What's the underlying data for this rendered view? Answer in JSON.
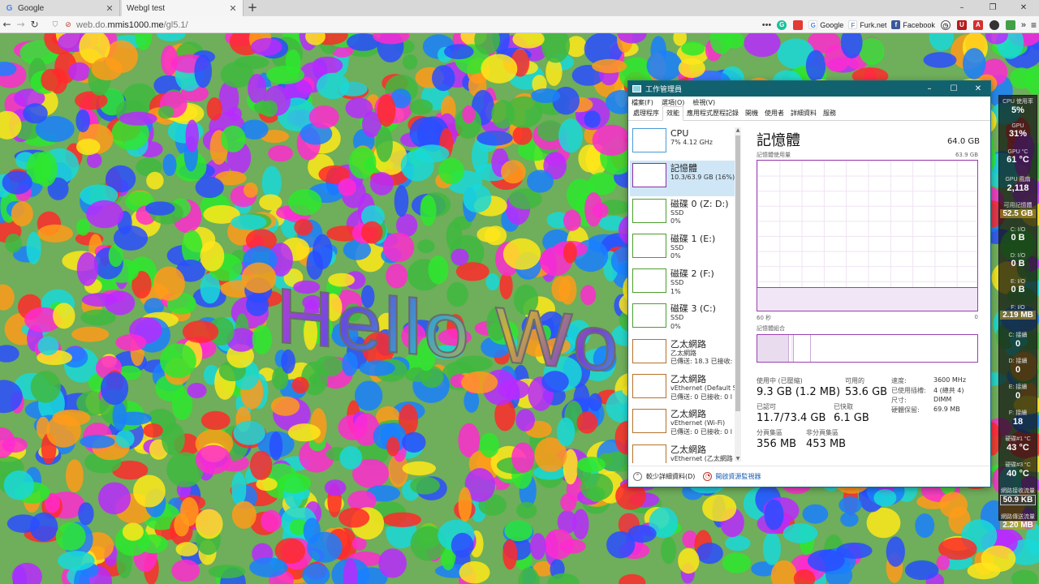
{
  "browser": {
    "tabs": [
      {
        "label": "Google",
        "favicon": "G"
      },
      {
        "label": "Webgl test",
        "favicon": ""
      }
    ],
    "url_prefix": "web.do.",
    "url_host": "mmis1000.me",
    "url_path": "/gl5.1/",
    "bookmarks": [
      "Google",
      "Furk.net",
      "Facebook"
    ],
    "window_controls": [
      "–",
      "❐",
      "✕"
    ]
  },
  "canvas": {
    "text": "Hello Wo"
  },
  "taskmgr": {
    "title": "工作管理員",
    "menu": [
      "檔案(F)",
      "選項(O)",
      "檢視(V)"
    ],
    "tabs": [
      "處理程序",
      "效能",
      "應用程式歷程記錄",
      "開機",
      "使用者",
      "詳細資料",
      "服務"
    ],
    "active_tab": "效能",
    "items": [
      {
        "name": "CPU",
        "sub1": "7% 4.12 GHz",
        "sub2": "",
        "sub3": "",
        "kind": "cpu"
      },
      {
        "name": "記憶體",
        "sub1": "10.3/63.9 GB (16%)",
        "sub2": "",
        "sub3": "",
        "kind": "mem"
      },
      {
        "name": "磁碟 0 (Z: D:)",
        "sub1": "SSD",
        "sub2": "0%",
        "sub3": "",
        "kind": "disk"
      },
      {
        "name": "磁碟 1 (E:)",
        "sub1": "SSD",
        "sub2": "0%",
        "sub3": "",
        "kind": "disk"
      },
      {
        "name": "磁碟 2 (F:)",
        "sub1": "SSD",
        "sub2": "1%",
        "sub3": "",
        "kind": "disk"
      },
      {
        "name": "磁碟 3 (C:)",
        "sub1": "SSD",
        "sub2": "0%",
        "sub3": "",
        "kind": "disk"
      },
      {
        "name": "乙太網路",
        "sub1": "乙太網路",
        "sub2": "已傳送: 18.3 已接收:",
        "sub3": "",
        "kind": "net"
      },
      {
        "name": "乙太網路",
        "sub1": "vEthernet (Default S",
        "sub2": "已傳送: 0 已接收: 0 l",
        "sub3": "",
        "kind": "net"
      },
      {
        "name": "乙太網路",
        "sub1": "vEthernet (Wi-Fi)",
        "sub2": "已傳送: 0 已接收: 0 l",
        "sub3": "",
        "kind": "net"
      },
      {
        "name": "乙太網路",
        "sub1": "vEthernet (乙太網路",
        "sub2": "",
        "sub3": "",
        "kind": "net"
      }
    ],
    "detail": {
      "title": "記憶體",
      "total": "64.0 GB",
      "usage_label": "記憶體使用量",
      "usage_max": "63.9 GB",
      "axis_left": "60 秒",
      "axis_right": "0",
      "composition_label": "記憶體組合",
      "stats": {
        "in_use_label": "使用中 (已壓縮)",
        "in_use_value": "9.3 GB (1.2 MB)",
        "available_label": "可用的",
        "available_value": "53.6 GB",
        "committed_label": "已認可",
        "committed_value": "11.7/73.4 GB",
        "cached_label": "已快取",
        "cached_value": "6.1 GB",
        "paged_label": "分頁集區",
        "paged_value": "356 MB",
        "nonpaged_label": "非分頁集區",
        "nonpaged_value": "453 MB"
      },
      "props": [
        {
          "k": "速度:",
          "v": "3600 MHz"
        },
        {
          "k": "已使用插槽:",
          "v": "4 (總共 4)"
        },
        {
          "k": "尺寸:",
          "v": "DIMM"
        },
        {
          "k": "硬體保留:",
          "v": "69.9 MB"
        }
      ]
    },
    "footer": {
      "fewer_details": "較少詳細資料(D)",
      "open_monitor": "開啟資源監視器"
    }
  },
  "gadget": {
    "rows": [
      {
        "label": "CPU 使用率",
        "value": "5%",
        "style": ""
      },
      {
        "label": "GPU",
        "value": "31%",
        "style": ""
      },
      {
        "label": "GPU °C",
        "value": "61 °C",
        "style": ""
      },
      {
        "label": "GPU 風扇",
        "value": "2,118",
        "style": ""
      },
      {
        "label": "可用記憶體",
        "value": "52.5 GB",
        "style": "boxed"
      },
      {
        "label": "C: I/O",
        "value": "0 B",
        "style": ""
      },
      {
        "label": "D: I/O",
        "value": "0 B",
        "style": ""
      },
      {
        "label": "E: I/O",
        "value": "0 B",
        "style": ""
      },
      {
        "label": "F: I/O",
        "value": "2.19 MB",
        "style": "boxed"
      },
      {
        "label": "C: 接續",
        "value": "0",
        "style": ""
      },
      {
        "label": "D: 接續",
        "value": "0",
        "style": ""
      },
      {
        "label": "E: 接續",
        "value": "0",
        "style": ""
      },
      {
        "label": "F: 接續",
        "value": "18",
        "style": ""
      },
      {
        "label": "硬碟#1 °C",
        "value": "43 °C",
        "style": ""
      },
      {
        "label": "硬碟#3 °C",
        "value": "40 °C",
        "style": ""
      },
      {
        "label": "網路接收流量",
        "value": "50.9 KB",
        "style": "boxed2"
      },
      {
        "label": "網路傳送流量",
        "value": "2.20 MB",
        "style": "boxed"
      }
    ]
  }
}
